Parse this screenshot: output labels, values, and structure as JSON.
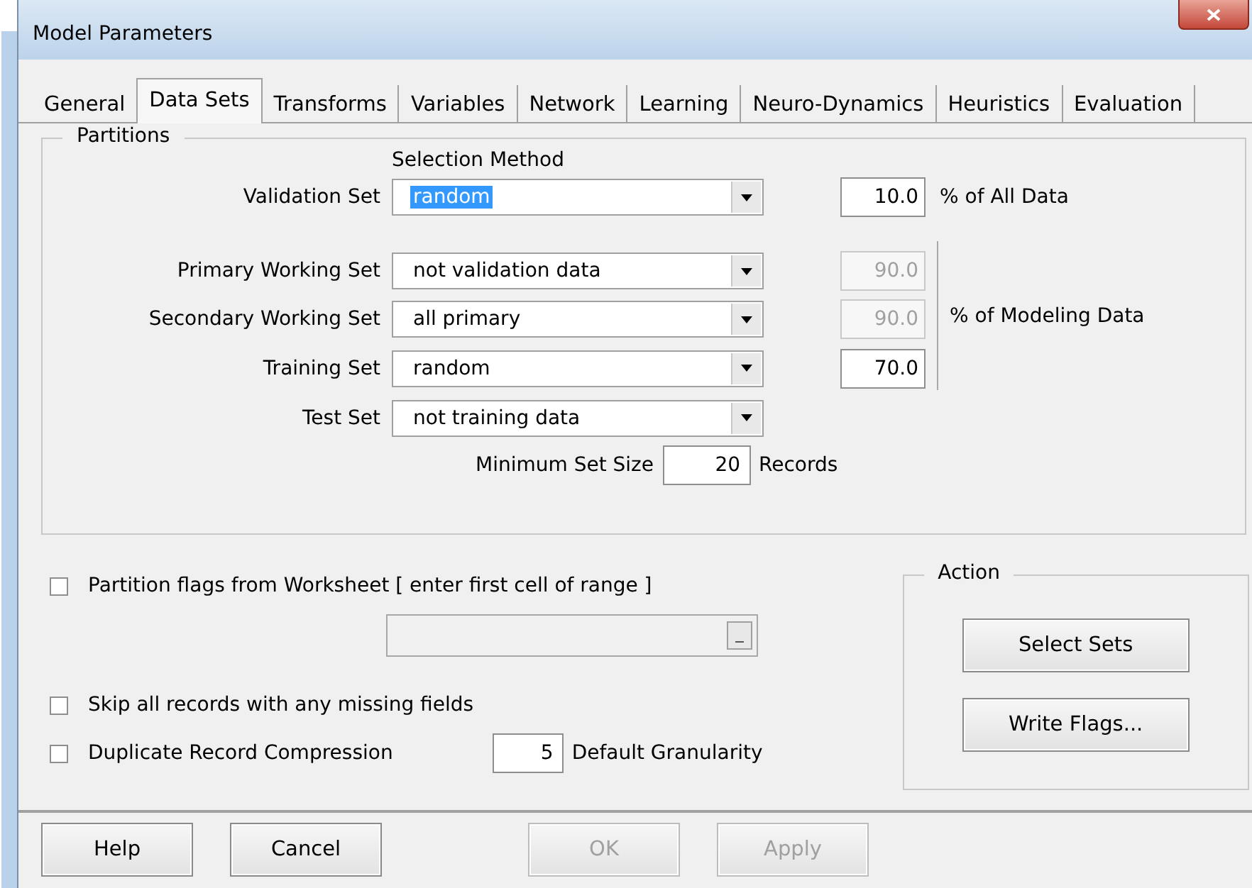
{
  "window": {
    "title": "Model Parameters"
  },
  "tabs": [
    {
      "label": "General",
      "selected": false
    },
    {
      "label": "Data Sets",
      "selected": true
    },
    {
      "label": "Transforms",
      "selected": false
    },
    {
      "label": "Variables",
      "selected": false
    },
    {
      "label": "Network",
      "selected": false
    },
    {
      "label": "Learning",
      "selected": false
    },
    {
      "label": "Neuro-Dynamics",
      "selected": false
    },
    {
      "label": "Heuristics",
      "selected": false
    },
    {
      "label": "Evaluation",
      "selected": false
    }
  ],
  "partitions": {
    "title": "Partitions",
    "column_heading": "Selection Method",
    "validation": {
      "label": "Validation Set",
      "value": "random",
      "highlighted": true,
      "percent": "10.0",
      "percent_disabled": false,
      "suffix": "% of All Data"
    },
    "sets": [
      {
        "label": "Primary Working Set",
        "value": "not validation data",
        "highlighted": false,
        "percent": "90.0",
        "percent_disabled": true
      },
      {
        "label": "Secondary Working Set",
        "value": "all primary",
        "highlighted": false,
        "percent": "90.0",
        "percent_disabled": true
      },
      {
        "label": "Training Set",
        "value": "random",
        "highlighted": false,
        "percent": "70.0",
        "percent_disabled": false
      },
      {
        "label": "Test Set",
        "value": "not training data",
        "highlighted": false
      }
    ],
    "sets_suffix": "% of Modeling Data",
    "minimum": {
      "label": "Minimum Set Size",
      "value": "20",
      "unit": "Records"
    }
  },
  "partition_flags": {
    "label": "Partition flags from Worksheet [ enter first cell of range ]",
    "checked": false,
    "range_disabled": true
  },
  "skip_missing": {
    "label": "Skip all records with any missing fields",
    "checked": false
  },
  "duplicate": {
    "label": "Duplicate Record Compression",
    "checked": false,
    "granularity": "5",
    "granularity_label": "Default Granularity"
  },
  "action": {
    "title": "Action",
    "buttons": [
      {
        "label": "Select Sets"
      },
      {
        "label": "Write Flags..."
      }
    ]
  },
  "buttons": [
    {
      "label": "Help",
      "disabled": false
    },
    {
      "label": "Cancel",
      "disabled": false
    },
    {
      "label": "OK",
      "disabled": true
    },
    {
      "label": "Apply",
      "disabled": true
    }
  ]
}
